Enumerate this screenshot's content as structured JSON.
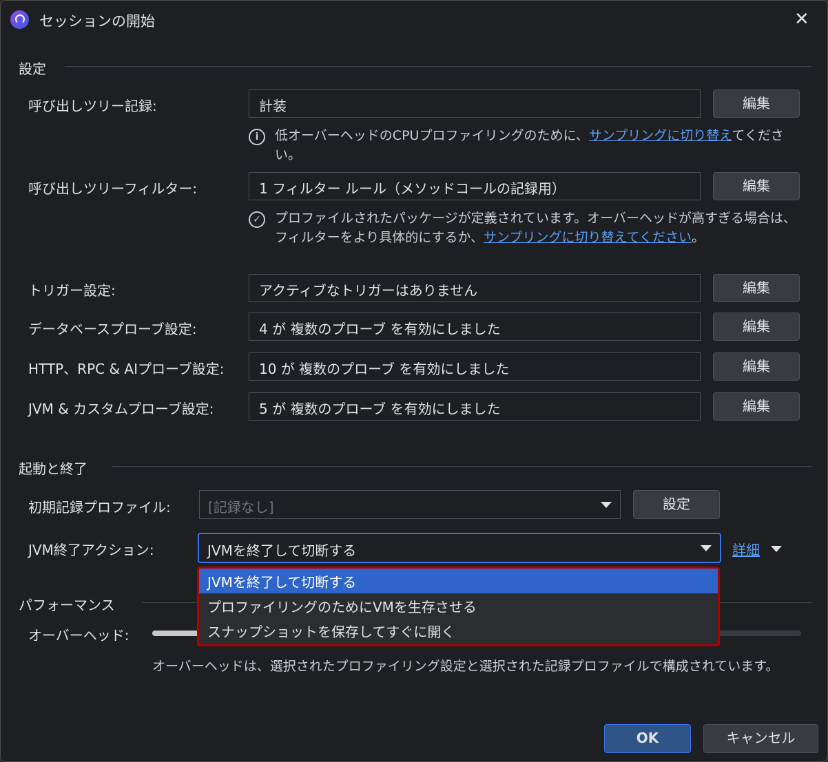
{
  "title": "セッションの開始",
  "sections": {
    "settings": "設定",
    "startup": "起動と終了",
    "performance": "パフォーマンス"
  },
  "rows": [
    {
      "label": "呼び出しツリー記録:",
      "value": "計装",
      "button": "編集"
    },
    {
      "label": "呼び出しツリーフィルター:",
      "value": "1 フィルター ルール（メソッドコールの記録用）",
      "button": "編集"
    },
    {
      "label": "トリガー設定:",
      "value": "アクティブなトリガーはありません",
      "button": "編集"
    },
    {
      "label": "データベースプローブ設定:",
      "value": "4 が 複数のプローブ を有効にしました",
      "button": "編集"
    },
    {
      "label": "HTTP、RPC & AIプローブ設定:",
      "value": "10 が 複数のプローブ を有効にしました",
      "button": "編集"
    },
    {
      "label": "JVM & カスタムプローブ設定:",
      "value": "5 が 複数のプローブ を有効にしました",
      "button": "編集"
    }
  ],
  "notes": {
    "n1_text": "低オーバーヘッドのCPUプロファイリングのために、",
    "n1_link": "サンプリングに切り替え",
    "n1_tail": "てください。",
    "n2_text": "プロファイルされたパッケージが定義されています。オーバーヘッドが高すぎる場合は、フィルターをより具体的にするか、",
    "n2_link": "サンプリングに切り替えてください",
    "n2_tail": "。"
  },
  "startup": {
    "initial_label": "初期記録プロファイル:",
    "initial_value": "[記録なし]",
    "initial_button": "設定",
    "exit_label": "JVM終了アクション:",
    "exit_value": "JVMを終了して切断する",
    "details_link": "詳細",
    "options": [
      "JVMを終了して切断する",
      "プロファイリングのためにVMを生存させる",
      "スナップショットを保存してすぐに開く"
    ]
  },
  "performance": {
    "overhead_label": "オーバーヘッド:",
    "description": "オーバーヘッドは、選択されたプロファイリング設定と選択された記録プロファイルで構成されています。"
  },
  "buttons": {
    "ok": "OK",
    "cancel": "キャンセル"
  }
}
